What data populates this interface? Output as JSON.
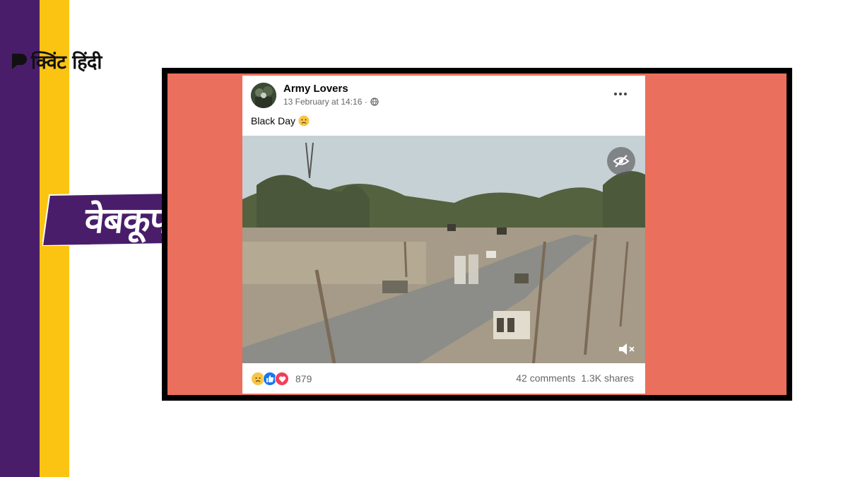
{
  "brand": {
    "name": "क्विंट हिंदी"
  },
  "tag": {
    "label": "वेबकूफ"
  },
  "colors": {
    "purple": "#4a1d6b",
    "yellow": "#fbc412",
    "salmon": "#ea6f5c",
    "tag_bg": "#4a1d6b"
  },
  "post": {
    "author": "Army Lovers",
    "date": "13 February at 14:16 ·",
    "caption": "Black Day",
    "caption_emoji": "sad-face-icon",
    "reaction_count": "879",
    "comments": "42 comments",
    "shares": "1.3K shares",
    "reactions": [
      "sad-reaction-icon",
      "like-reaction-icon",
      "love-reaction-icon"
    ]
  }
}
